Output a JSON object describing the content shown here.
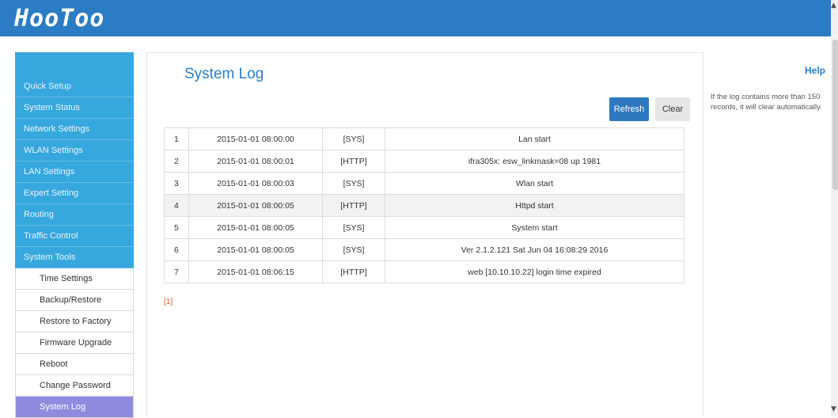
{
  "brand": {
    "logo_text": "HooToo"
  },
  "sidebar": {
    "main_items": [
      {
        "label": "Quick Setup"
      },
      {
        "label": "System Status"
      },
      {
        "label": "Network Settings"
      },
      {
        "label": "WLAN Settings"
      },
      {
        "label": "LAN Settings"
      },
      {
        "label": "Expert Setting"
      },
      {
        "label": "Routing"
      },
      {
        "label": "Traffic Control"
      },
      {
        "label": "System Tools"
      }
    ],
    "sub_items": [
      {
        "label": "Time Settings"
      },
      {
        "label": "Backup/Restore"
      },
      {
        "label": "Restore to Factory"
      },
      {
        "label": "Firmware Upgrade"
      },
      {
        "label": "Reboot"
      },
      {
        "label": "Change Password"
      },
      {
        "label": "System Log"
      }
    ],
    "active": "System Log"
  },
  "main": {
    "title": "System Log",
    "refresh_label": "Refresh",
    "clear_label": "Clear",
    "log_rows": [
      {
        "index": "1",
        "time": "2015-01-01 08:00:00",
        "type": "[SYS]",
        "message": "Lan start"
      },
      {
        "index": "2",
        "time": "2015-01-01 08:00:01",
        "type": "[HTTP]",
        "message": "ifra305x: esw_linkmask=08 up 1981"
      },
      {
        "index": "3",
        "time": "2015-01-01 08:00:03",
        "type": "[SYS]",
        "message": "Wlan start"
      },
      {
        "index": "4",
        "time": "2015-01-01 08:00:05",
        "type": "[HTTP]",
        "message": "Httpd start"
      },
      {
        "index": "5",
        "time": "2015-01-01 08:00:05",
        "type": "[SYS]",
        "message": "System start"
      },
      {
        "index": "6",
        "time": "2015-01-01 08:00:05",
        "type": "[SYS]",
        "message": "Ver 2.1.2.121 Sat Jun 04 16:08:29 2016"
      },
      {
        "index": "7",
        "time": "2015-01-01 08:06:15",
        "type": "[HTTP]",
        "message": "web [10.10.10.22] login time expired"
      }
    ],
    "pager": "[1]"
  },
  "help": {
    "title": "Help",
    "text": "If the log contains more than 150 records, it will clear automatically."
  },
  "colors": {
    "header": "#2b7cc4",
    "sidebar_main": "#37a8de",
    "sidebar_active": "#8f8ce0",
    "accent": "#2b7cc4",
    "pager": "#e05a2a"
  }
}
